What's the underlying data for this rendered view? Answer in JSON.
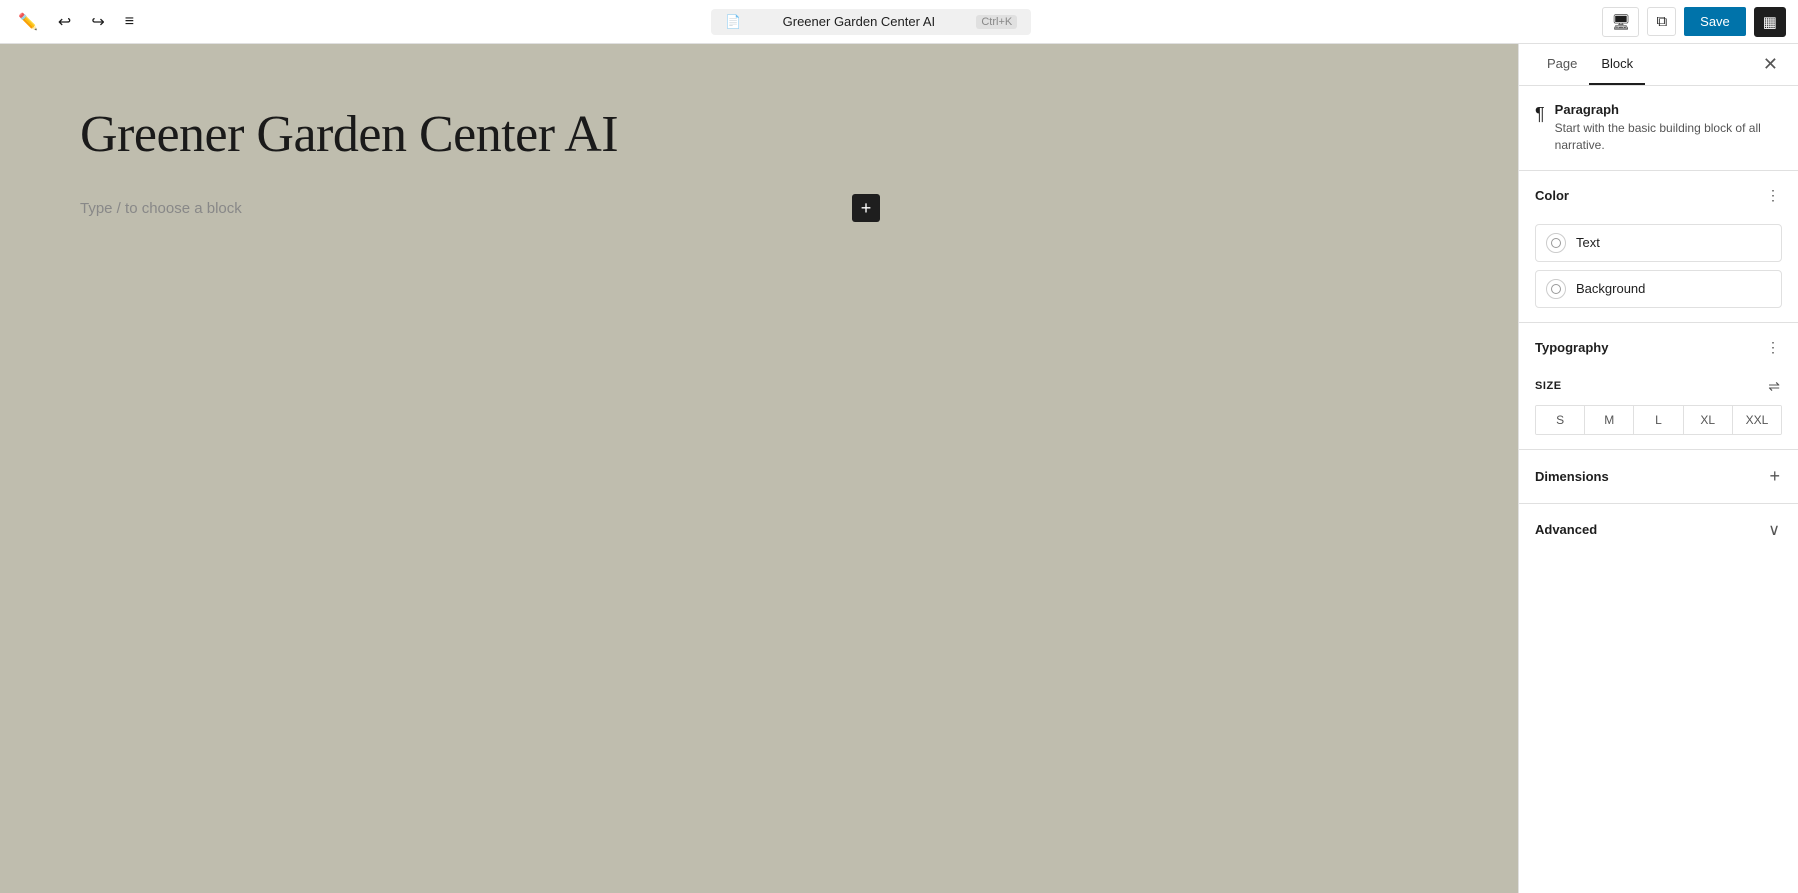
{
  "toolbar": {
    "search_text": "Greener Garden Center AI",
    "shortcut": "Ctrl+K",
    "save_label": "Save",
    "undo_icon": "↩",
    "redo_icon": "↪",
    "menu_icon": "≡",
    "edit_icon": "✎",
    "preview_icon": "⧉",
    "view_icon": "▦"
  },
  "canvas": {
    "page_title": "Greener Garden Center AI",
    "placeholder_text": "Type / to choose a block"
  },
  "sidebar": {
    "tabs": [
      {
        "label": "Page",
        "active": false
      },
      {
        "label": "Block",
        "active": true
      }
    ],
    "block_info": {
      "name": "Paragraph",
      "description": "Start with the basic building block of all narrative."
    },
    "color_section": {
      "label": "Color",
      "options": [
        {
          "label": "Text"
        },
        {
          "label": "Background"
        }
      ]
    },
    "typography_section": {
      "label": "Typography",
      "size_label": "SIZE",
      "sizes": [
        "S",
        "M",
        "L",
        "XL",
        "XXL"
      ]
    },
    "dimensions_section": {
      "label": "Dimensions"
    },
    "advanced_section": {
      "label": "Advanced"
    }
  }
}
